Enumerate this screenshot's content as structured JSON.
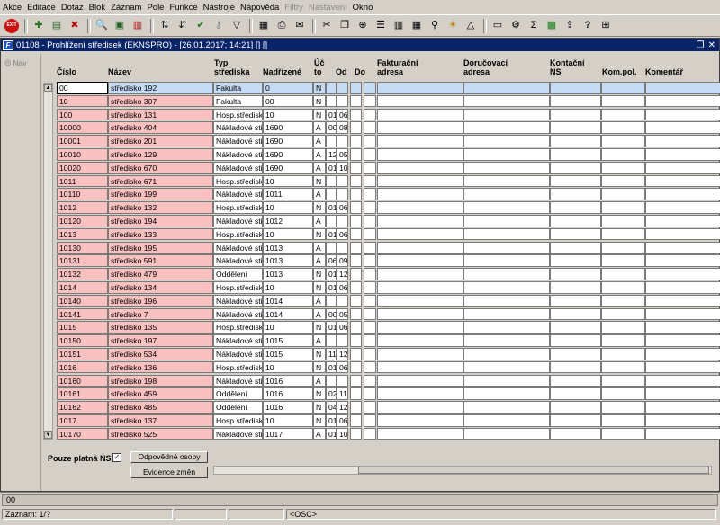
{
  "menu": [
    "Akce",
    "Editace",
    "Dotaz",
    "Blok",
    "Záznam",
    "Pole",
    "Funkce",
    "Nástroje",
    "Nápověda",
    "Filtry",
    "Nastavení",
    "Okno"
  ],
  "menu_disabled": [
    "Filtry",
    "Nastavení"
  ],
  "exit_label": "EXIT",
  "window": {
    "title": "01108 - Prohlížení středisek (EKNSPRO) - [26.01.2017; 14:21] [] []",
    "icon_letter": "F"
  },
  "nav_label": "Nav",
  "columns": {
    "cislo": "Číslo",
    "nazev": "Název",
    "typ": [
      "Typ",
      "střediska"
    ],
    "nadrizene": "Nadřízené",
    "uc": [
      "Úč",
      "to"
    ],
    "od": "Od",
    "do": "Do",
    "fakt": [
      "Fakturační",
      "adresa"
    ],
    "doruc": [
      "Doručovací",
      "adresa"
    ],
    "kontakt": [
      "Kontační",
      "NS"
    ],
    "kompol": "Kom.pol.",
    "komentar": "Komentář"
  },
  "rows": [
    [
      "00",
      "středisko 192",
      "Fakulta",
      "0",
      "N",
      "",
      ""
    ],
    [
      "10",
      "středisko 307",
      "Fakulta",
      "00",
      "N",
      "",
      ""
    ],
    [
      "100",
      "středisko 131",
      "Hosp.středisk",
      "10",
      "N",
      "01",
      "06"
    ],
    [
      "10000",
      "středisko 404",
      "Nákladové stř",
      "1690",
      "A",
      "00",
      "08"
    ],
    [
      "10001",
      "středisko 201",
      "Nákladové stř",
      "1690",
      "A",
      "",
      ""
    ],
    [
      "10010",
      "středisko 129",
      "Nákladové stř",
      "1690",
      "A",
      "12",
      "05"
    ],
    [
      "10020",
      "středisko 670",
      "Nákladové stř",
      "1690",
      "A",
      "01",
      "10"
    ],
    [
      "1011",
      "středisko 671",
      "Hosp.středisk",
      "10",
      "N",
      "",
      ""
    ],
    [
      "10110",
      "středisko 199",
      "Nákladové stř",
      "1011",
      "A",
      "",
      ""
    ],
    [
      "1012",
      "středisko 132",
      "Hosp.středisk",
      "10",
      "N",
      "01",
      "06"
    ],
    [
      "10120",
      "středisko 194",
      "Nákladové stř",
      "1012",
      "A",
      "",
      ""
    ],
    [
      "1013",
      "středisko 133",
      "Hosp.středisk",
      "10",
      "N",
      "01",
      "06"
    ],
    [
      "10130",
      "středisko 195",
      "Nákladové stř",
      "1013",
      "A",
      "",
      ""
    ],
    [
      "10131",
      "středisko 591",
      "Nákladové stř",
      "1013",
      "A",
      "06",
      "09"
    ],
    [
      "10132",
      "středisko 479",
      "Oddělení",
      "1013",
      "N",
      "01",
      "12"
    ],
    [
      "1014",
      "středisko 134",
      "Hosp.středisk",
      "10",
      "N",
      "01",
      "06"
    ],
    [
      "10140",
      "středisko 196",
      "Nákladové stř",
      "1014",
      "A",
      "",
      ""
    ],
    [
      "10141",
      "středisko 7",
      "Nákladové stř",
      "1014",
      "A",
      "00",
      "05"
    ],
    [
      "1015",
      "středisko 135",
      "Hosp.středisk",
      "10",
      "N",
      "01",
      "06"
    ],
    [
      "10150",
      "středisko 197",
      "Nákladové stř",
      "1015",
      "A",
      "",
      ""
    ],
    [
      "10151",
      "středisko 534",
      "Nákladové stř",
      "1015",
      "N",
      "11",
      "12"
    ],
    [
      "1016",
      "středisko 136",
      "Hosp.středisk",
      "10",
      "N",
      "01",
      "06"
    ],
    [
      "10160",
      "středisko 198",
      "Nákladové stř",
      "1016",
      "A",
      "",
      ""
    ],
    [
      "10161",
      "středisko 459",
      "Oddělení",
      "1016",
      "N",
      "02",
      "11"
    ],
    [
      "10162",
      "středisko 485",
      "Oddělení",
      "1016",
      "N",
      "04",
      "12"
    ],
    [
      "1017",
      "středisko 137",
      "Hosp.středisk",
      "10",
      "N",
      "01",
      "06"
    ],
    [
      "10170",
      "středisko 525",
      "Nákladové stř",
      "1017",
      "A",
      "01",
      "10"
    ]
  ],
  "bottom": {
    "pouze_label": "Pouze platná NS",
    "pouze_checked": "✓",
    "btn_odpovedne": "Odpovědné osoby",
    "btn_evidence": "Evidence změn"
  },
  "status": {
    "message": "00",
    "zaznam": "Záznam: 1/?",
    "mode": "<OSC>"
  },
  "colors": {
    "pink": "#f9c0c0",
    "selected": "#c6dcf5",
    "titlebar": "#0a246a"
  }
}
